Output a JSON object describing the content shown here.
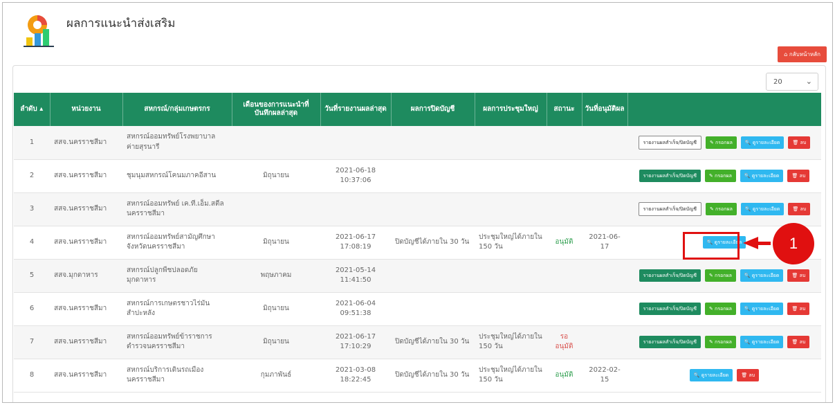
{
  "header": {
    "title": "ผลการแนะนำส่งเสริม",
    "home_button": "⌂ กลับหน้าหลัก"
  },
  "page_size": {
    "value": "20"
  },
  "table": {
    "columns": [
      "ลำดับ",
      "หน่วยงาน",
      "สหกรณ์/กลุ่มเกษตรกร",
      "เดือนของการแนะนำที่บันทึกผลล่าสุด",
      "วันที่รายงานผลล่าสุด",
      "ผลการปิดบัญชี",
      "ผลการประชุมใหญ่",
      "สถานะ",
      "วันที่อนุมัติผล",
      ""
    ],
    "rows": [
      {
        "no": "1",
        "unit": "สสจ.นครราชสีมา",
        "coop": "สหกรณ์ออมทรัพย์โรงพยาบาลค่ายสุรนารี",
        "month": "",
        "date": "",
        "time": "",
        "close": "",
        "meeting": "",
        "status": "",
        "approve": ""
      },
      {
        "no": "2",
        "unit": "สสจ.นครราชสีมา",
        "coop": "ชุมนุมสหกรณ์โคนมภาคอีสาน",
        "month": "มิถุนายน",
        "date": "2021-06-18",
        "time": "10:37:06",
        "close": "",
        "meeting": "",
        "status": "",
        "approve": ""
      },
      {
        "no": "3",
        "unit": "สสจ.นครราชสีมา",
        "coop": "สหกรณ์ออมทรัพย์ เค.ที.เอ็ม.สตีล นครราชสีมา",
        "month": "",
        "date": "",
        "time": "",
        "close": "",
        "meeting": "",
        "status": "",
        "approve": ""
      },
      {
        "no": "4",
        "unit": "สสจ.นครราชสีมา",
        "coop": "สหกรณ์ออมทรัพย์สามัญศึกษาจังหวัดนครราชสีมา",
        "month": "มิถุนายน",
        "date": "2021-06-17",
        "time": "17:08:19",
        "close": "ปิดบัญชีได้ภายใน 30 วัน",
        "meeting": "ประชุมใหญ่ได้ภายใน 150 วัน",
        "status": "อนุมัติ",
        "approve": "2021-06-17"
      },
      {
        "no": "5",
        "unit": "สสจ.มุกดาหาร",
        "coop": "สหกรณ์ปลูกพืชปลอดภัย มุกดาหาร",
        "month": "พฤษภาคม",
        "date": "2021-05-14",
        "time": "11:41:50",
        "close": "",
        "meeting": "",
        "status": "",
        "approve": ""
      },
      {
        "no": "6",
        "unit": "สสจ.นครราชสีมา",
        "coop": "สหกรณ์การเกษตรชาวไร่มันสำปะหลัง",
        "month": "มิถุนายน",
        "date": "2021-06-04",
        "time": "09:51:38",
        "close": "",
        "meeting": "",
        "status": "",
        "approve": ""
      },
      {
        "no": "7",
        "unit": "สสจ.นครราชสีมา",
        "coop": "สหกรณ์ออมทรัพย์ข้าราชการตำรวจนครราชสีมา",
        "month": "มิถุนายน",
        "date": "2021-06-17",
        "time": "17:10:29",
        "close": "ปิดบัญชีได้ภายใน 30 วัน",
        "meeting": "ประชุมใหญ่ได้ภายใน 150 วัน",
        "status": "รอ อนุมัติ",
        "approve": ""
      },
      {
        "no": "8",
        "unit": "สสจ.นครราชสีมา",
        "coop": "สหกรณ์บริการเดินรถเมือง นครราชสีมา",
        "month": "กุมภาพันธ์",
        "date": "2021-03-08",
        "time": "18:22:45",
        "close": "ปิดบัญชีได้ภายใน 30 วัน",
        "meeting": "ประชุมใหญ่ได้ภายใน 150 วัน",
        "status": "อนุมัติ",
        "approve": "2022-02-15"
      }
    ]
  },
  "buttons": {
    "report": "รายงานผลสำเร็จ/ปิดบัญชี",
    "record": "✎ กรอกผล",
    "detail": "🔍 ดูรายละเอียด",
    "delete": "🗑 ลบ"
  },
  "annotation": {
    "marker": "1"
  },
  "colors": {
    "header_green": "#1e8b5f",
    "danger": "#e53935",
    "info": "#2fb8f0",
    "annotation_red": "#e01010"
  }
}
